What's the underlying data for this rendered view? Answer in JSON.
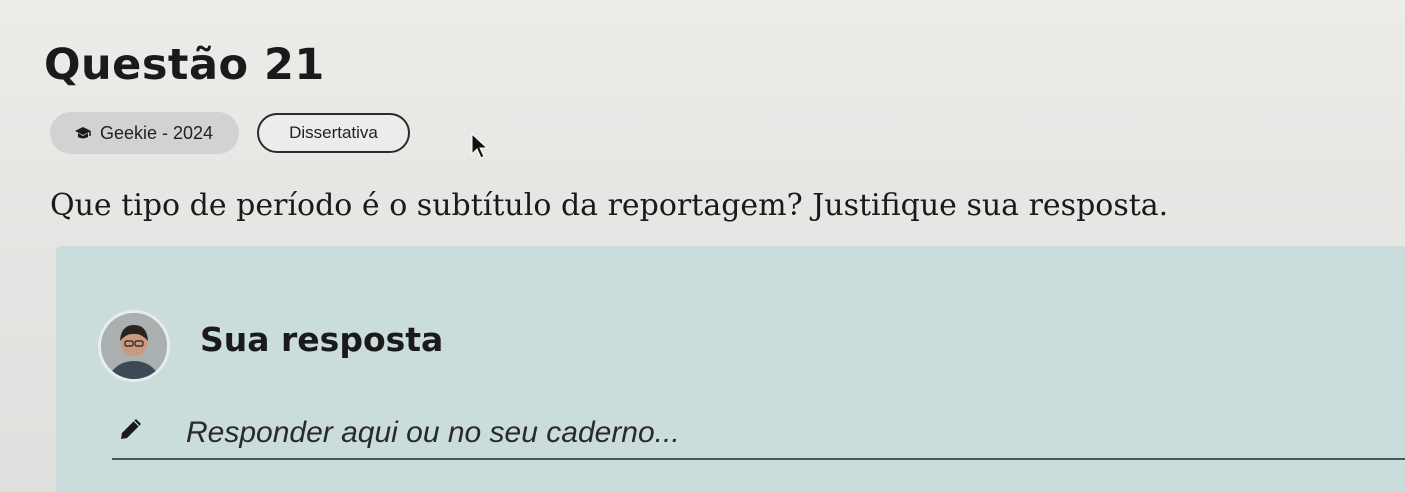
{
  "question": {
    "title": "Questão 21",
    "tags": {
      "source": "Geekie - 2024",
      "source_icon": "graduation-cap-icon",
      "type": "Dissertativa"
    },
    "prompt": "Que tipo de período é o subtítulo da reportagem? Justifique sua resposta."
  },
  "answer": {
    "label": "Sua resposta",
    "placeholder": "Responder aqui ou no seu caderno...",
    "value": "",
    "edit_icon": "pencil-icon"
  },
  "colors": {
    "answer_panel": "#cbdcdc",
    "tag_background": "#d0d3d2",
    "page_background": "#e6e6e3"
  }
}
